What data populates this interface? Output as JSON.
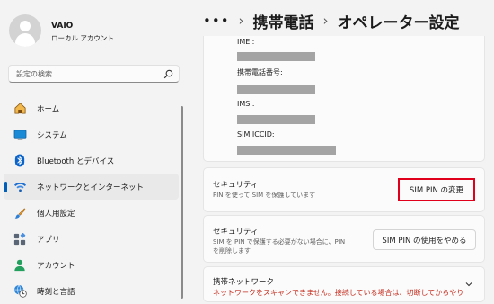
{
  "user": {
    "name": "VAIO",
    "account_type": "ローカル アカウント"
  },
  "search": {
    "placeholder": "設定の検索"
  },
  "nav": {
    "items": [
      {
        "label": "ホーム",
        "icon": "home-icon"
      },
      {
        "label": "システム",
        "icon": "monitor-icon"
      },
      {
        "label": "Bluetooth とデバイス",
        "icon": "bluetooth-icon"
      },
      {
        "label": "ネットワークとインターネット",
        "icon": "wifi-icon",
        "selected": true
      },
      {
        "label": "個人用設定",
        "icon": "paintbrush-icon"
      },
      {
        "label": "アプリ",
        "icon": "apps-icon"
      },
      {
        "label": "アカウント",
        "icon": "account-icon"
      },
      {
        "label": "時刻と言語",
        "icon": "clock-globe-icon"
      }
    ]
  },
  "breadcrumb": {
    "more": "•••",
    "separator": "›",
    "parent": "携帯電話",
    "current": "オペレーター設定"
  },
  "info": {
    "imei_label": "IMEI:",
    "phone_label": "携帯電話番号:",
    "imsi_label": "IMSI:",
    "iccid_label": "SIM ICCID:"
  },
  "security1": {
    "title": "セキュリティ",
    "subtitle": "PIN を使って SIM を保護しています",
    "button": "SIM PIN の変更"
  },
  "security2": {
    "title": "セキュリティ",
    "subtitle_line1": "SIM を PIN で保護する必要がない場合に、PIN",
    "subtitle_line2": "を削除します",
    "button": "SIM PIN の使用をやめる"
  },
  "network": {
    "title": "携帯ネットワーク",
    "error": "ネットワークをスキャンできません。接続している場合は、切断してからやり"
  },
  "colors": {
    "accent": "#005fb8",
    "error": "#c42b1c",
    "highlight": "#e0001b"
  }
}
